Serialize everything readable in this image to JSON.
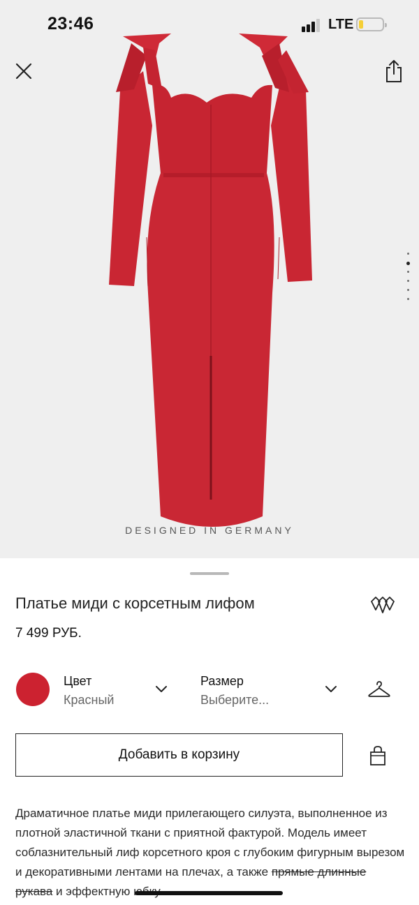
{
  "status_bar": {
    "time": "23:46",
    "network": "LTE",
    "signal_bars": 3,
    "battery_level": 0.2,
    "battery_color": "#f5cf37"
  },
  "gallery": {
    "close_icon": "close-icon",
    "share_icon": "share-icon",
    "image_caption": "DESIGNED IN GERMANY",
    "image_count": 6,
    "active_image": 2,
    "dress_color": "#cc2230"
  },
  "product": {
    "title": "Платье миди с корсетным лифом",
    "price": "7 499 РУБ.",
    "wishlist_icon": "wishlist-hearts-icon"
  },
  "options": {
    "color": {
      "label": "Цвет",
      "value": "Красный",
      "swatch": "#cc2230"
    },
    "size": {
      "label": "Размер",
      "value": "Выберите..."
    },
    "size_guide_icon": "hanger-icon"
  },
  "cart": {
    "add_label": "Добавить в корзину",
    "bag_icon": "shopping-bag-icon"
  },
  "description": {
    "lead": "Драматичное платье миди прилегающего силуэта, выполненное из плотной эластичной ткани с приятной фактурой. Модель имеет соблазнительный лиф корсетного кроя с глубоким фигурным вырезом и декоративными лентами на плечах, а также ",
    "strike": "прямые длинные рукава",
    "tail": " и эффектную юбку"
  }
}
